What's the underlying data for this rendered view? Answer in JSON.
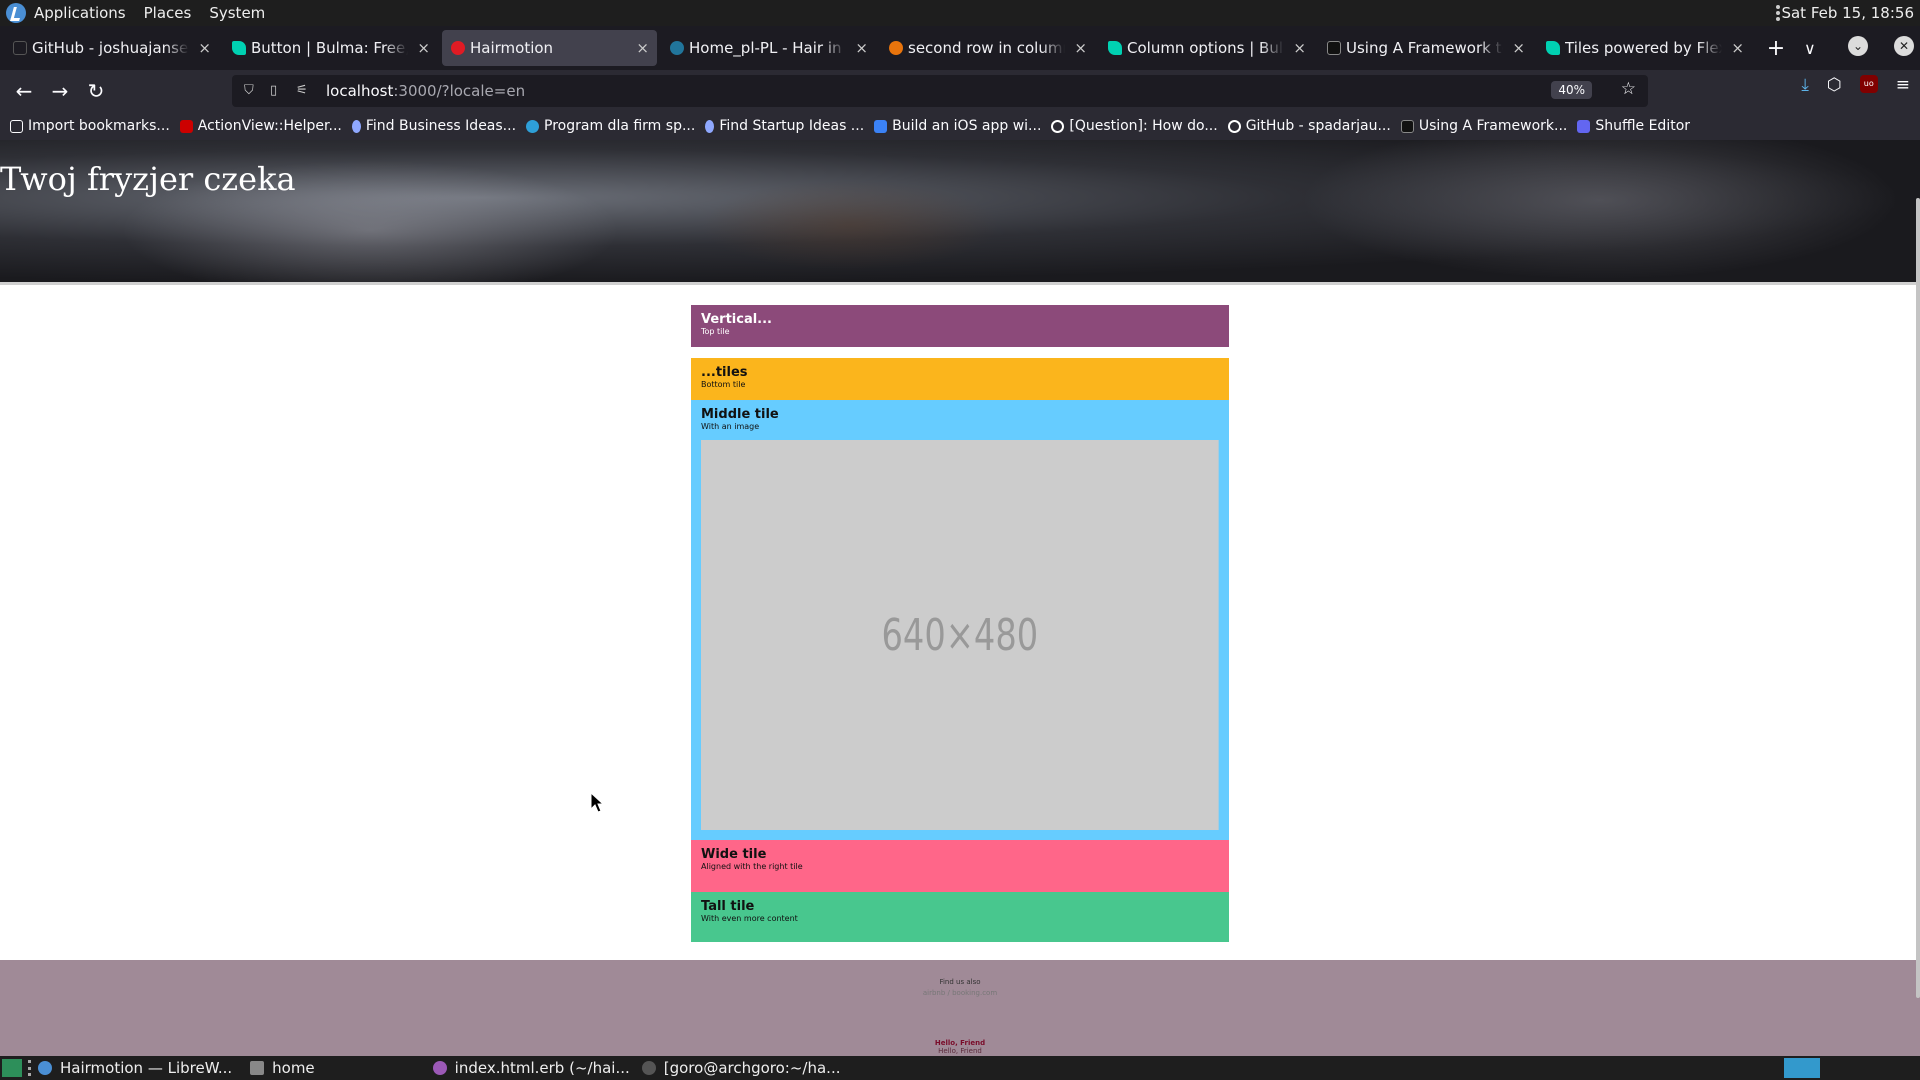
{
  "system_panel": {
    "menus": [
      "Applications",
      "Places",
      "System"
    ],
    "clock": "Sat Feb 15, 18:56"
  },
  "tabs": [
    {
      "label": "GitHub - joshuajansen/",
      "favicon_color": "#1c1b22",
      "active": false
    },
    {
      "label": "Button | Bulma: Free, c",
      "favicon_color": "#00d1b2",
      "active": false
    },
    {
      "label": "Hairmotion",
      "favicon_color": "#e01b24",
      "active": true
    },
    {
      "label": "Home_pl-PL - Hair in M",
      "favicon_color": "#21759b",
      "active": false
    },
    {
      "label": "second row in column b",
      "favicon_color": "#e8740c",
      "active": false
    },
    {
      "label": "Column options | Bulma",
      "favicon_color": "#00d1b2",
      "active": false
    },
    {
      "label": "Using A Framework to I",
      "favicon_color": "#111111",
      "active": false
    },
    {
      "label": "Tiles powered by Flexbo",
      "favicon_color": "#00d1b2",
      "active": false
    }
  ],
  "tab_close_glyph": "×",
  "tab_new_glyph": "+",
  "tab_list_glyph": "∨",
  "nav": {
    "back": "←",
    "forward": "→",
    "reload": "↻",
    "url_host": "localhost",
    "url_rest": ":3000/?locale=en",
    "zoom": "40%",
    "bookmark_star": "☆",
    "menu": "≡"
  },
  "bookmarks": [
    {
      "label": "Import bookmarks...",
      "color": "#fbfbfe"
    },
    {
      "label": "ActionView::Helper...",
      "color": "#cc0000"
    },
    {
      "label": "Find Business Ideas...",
      "color": "#8fa8ff"
    },
    {
      "label": "Program dla firm sp...",
      "color": "#2e9fd8"
    },
    {
      "label": "Find Startup Ideas ...",
      "color": "#8fa8ff"
    },
    {
      "label": "Build an iOS app wi...",
      "color": "#3b82f6"
    },
    {
      "label": "[Question]: How do...",
      "color": "#ffffff"
    },
    {
      "label": "GitHub - spadarjau...",
      "color": "#ffffff"
    },
    {
      "label": "Using A Framework...",
      "color": "#111111"
    },
    {
      "label": "Shuffle Editor",
      "color": "#6366f1"
    }
  ],
  "page": {
    "hero_title": "Twoj fryzjer czeka",
    "tiles": {
      "vertical": {
        "title": "Vertical...",
        "subtitle": "Top tile"
      },
      "tiles": {
        "title": "...tiles",
        "subtitle": "Bottom tile"
      },
      "middle": {
        "title": "Middle tile",
        "subtitle": "With an image",
        "image_text": "640×480"
      },
      "wide": {
        "title": "Wide tile",
        "subtitle": "Aligned with the right tile"
      },
      "tall": {
        "title": "Tall tile",
        "subtitle": "With even more content"
      }
    },
    "footer": {
      "find_us": "Find us also",
      "links": "airbnb / booking.com",
      "hello_bold": "Hello, Friend",
      "hello": "Hello, Friend"
    }
  },
  "taskbar": {
    "items": [
      {
        "label": "Hairmotion — LibreW...",
        "color": "#4a8fd4"
      },
      {
        "label": "home",
        "color": "#888888"
      },
      {
        "label": "index.html.erb (~/hai...",
        "color": "#9b59b6"
      },
      {
        "label": "[goro@archgoro:~/ha...",
        "color": "#555555"
      }
    ]
  },
  "colors": {
    "tile_vertical": "#8c4a7a",
    "tile_tiles": "#fbb51c",
    "tile_middle": "#66ccff",
    "tile_wide": "#ff6689",
    "tile_tall": "#48c78e",
    "footer": "#a08a97"
  }
}
